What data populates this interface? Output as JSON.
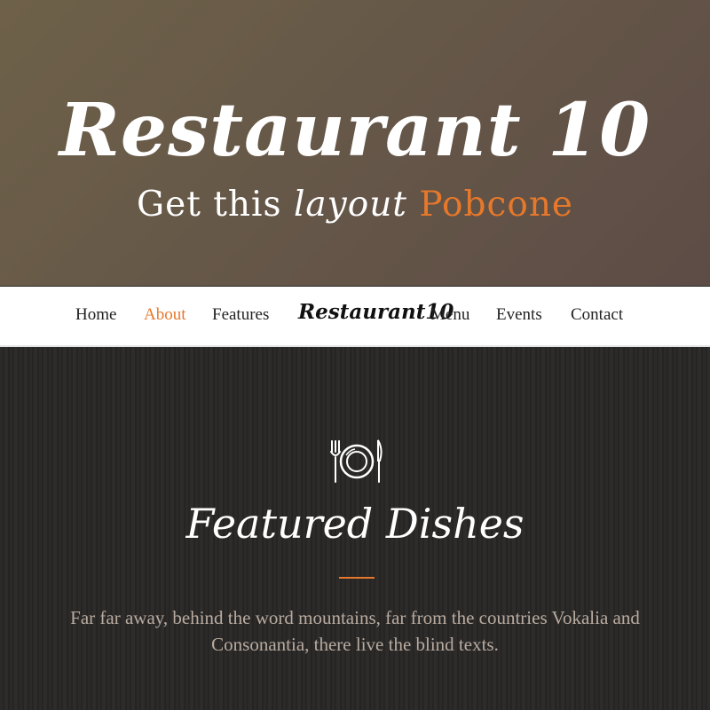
{
  "hero": {
    "title": "Restaurant 10",
    "subtitle_prefix": "Get this",
    "subtitle_italic": "layout",
    "subtitle_brand": "Pobcone"
  },
  "nav": {
    "home": "Home",
    "about": "About",
    "features": "Features",
    "logo": "Restaurant10",
    "menu": "Menu",
    "events": "Events",
    "contact": "Contact",
    "active": "About"
  },
  "featured": {
    "icon": "plate-fork-knife-icon",
    "title": "Featured Dishes",
    "text": "Far far away, behind the word mountains, far from the countries Vokalia and Consonantia, there live the blind texts."
  },
  "colors": {
    "accent": "#e6782b",
    "hero_bg": "#665848",
    "section_bg": "#2a2827",
    "nav_bg": "#ffffff",
    "body_text": "#b9aba0"
  }
}
